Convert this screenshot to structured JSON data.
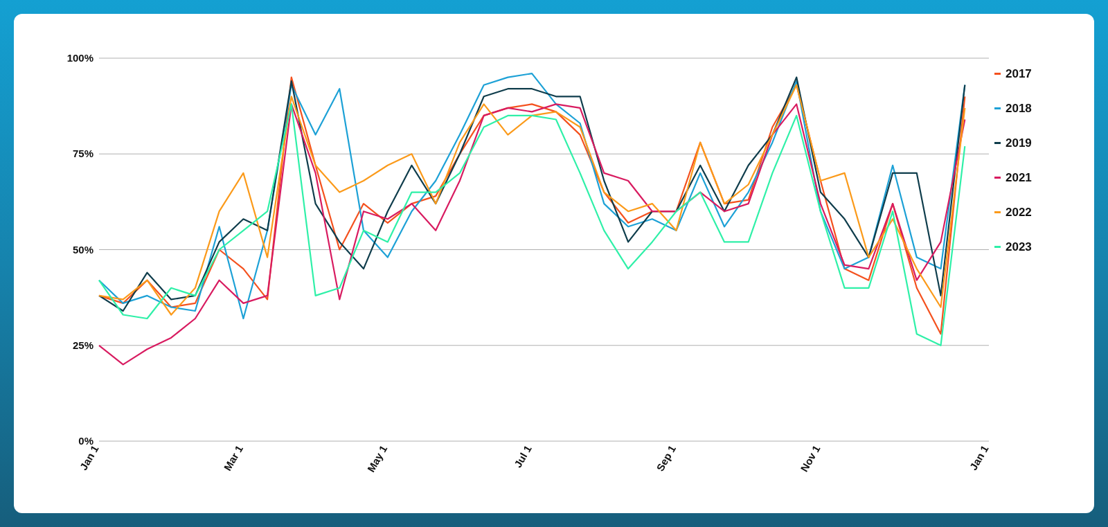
{
  "chart_data": {
    "type": "line",
    "grid": true,
    "categories": [
      "Jan 1",
      null,
      null,
      null,
      null,
      null,
      "Mar 1",
      null,
      null,
      null,
      null,
      null,
      "May 1",
      null,
      null,
      null,
      null,
      null,
      "Jul 1",
      null,
      null,
      null,
      null,
      null,
      "Sep 1",
      null,
      null,
      null,
      null,
      null,
      "Nov 1",
      null,
      null,
      null,
      null,
      null,
      null,
      "Jan 1"
    ],
    "ylim": [
      0,
      100
    ],
    "yticks": [
      {
        "value": 0,
        "label": "0%"
      },
      {
        "value": 25,
        "label": "25%"
      },
      {
        "value": 50,
        "label": "50%"
      },
      {
        "value": 75,
        "label": "75%"
      },
      {
        "value": 100,
        "label": "100%"
      }
    ],
    "series": [
      {
        "name": "2017",
        "color": "#f4511e",
        "values": [
          38,
          36,
          42,
          35,
          36,
          50,
          45,
          37,
          95,
          72,
          50,
          62,
          57,
          62,
          64,
          75,
          85,
          87,
          88,
          86,
          80,
          65,
          57,
          60,
          60,
          78,
          62,
          63,
          82,
          93,
          68,
          45,
          42,
          62,
          40,
          28,
          90,
          null
        ]
      },
      {
        "name": "2018",
        "color": "#1da1d6",
        "values": [
          42,
          36,
          38,
          35,
          34,
          56,
          32,
          55,
          93,
          80,
          92,
          55,
          48,
          60,
          68,
          80,
          93,
          95,
          96,
          88,
          83,
          62,
          56,
          58,
          55,
          70,
          56,
          65,
          78,
          94,
          60,
          45,
          48,
          72,
          48,
          45,
          93,
          null
        ]
      },
      {
        "name": "2019",
        "color": "#0f3d4c",
        "values": [
          38,
          34,
          44,
          37,
          38,
          52,
          58,
          55,
          94,
          62,
          52,
          45,
          60,
          72,
          62,
          75,
          90,
          92,
          92,
          90,
          90,
          68,
          52,
          60,
          60,
          72,
          60,
          72,
          80,
          95,
          65,
          58,
          48,
          70,
          70,
          38,
          93,
          null
        ]
      },
      {
        "name": "2021",
        "color": "#d81b60",
        "values": [
          25,
          20,
          24,
          27,
          32,
          42,
          36,
          38,
          88,
          70,
          37,
          60,
          58,
          62,
          55,
          68,
          85,
          87,
          86,
          88,
          87,
          70,
          68,
          60,
          60,
          65,
          60,
          62,
          80,
          88,
          62,
          46,
          45,
          62,
          42,
          52,
          84,
          null
        ]
      },
      {
        "name": "2022",
        "color": "#fb9a1a",
        "values": [
          38,
          37,
          42,
          33,
          40,
          60,
          70,
          48,
          90,
          72,
          65,
          68,
          72,
          75,
          62,
          78,
          88,
          80,
          85,
          86,
          82,
          65,
          60,
          62,
          55,
          78,
          62,
          67,
          80,
          93,
          68,
          70,
          48,
          58,
          45,
          35,
          87,
          null
        ]
      },
      {
        "name": "2023",
        "color": "#2ff0a8",
        "values": [
          42,
          33,
          32,
          40,
          38,
          50,
          55,
          60,
          88,
          38,
          40,
          55,
          52,
          65,
          65,
          70,
          82,
          85,
          85,
          84,
          70,
          55,
          45,
          52,
          60,
          65,
          52,
          52,
          70,
          85,
          60,
          40,
          40,
          60,
          28,
          25,
          77,
          null
        ]
      }
    ]
  }
}
